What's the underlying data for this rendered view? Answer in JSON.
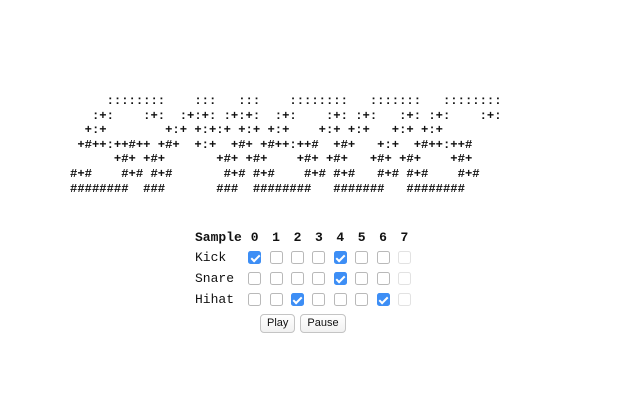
{
  "banner": {
    "lines": [
      "     ::::::::    :::   :::    ::::::::   :::::::   ::::::::",
      "   :+:    :+:  :+:+: :+:+:  :+:    :+: :+:   :+: :+:    :+:",
      "  +:+        +:+ +:+:+ +:+ +:+    +:+ +:+   +:+ +:+",
      " +#++:++#++ +#+  +:+  +#+ +#++:++#  +#+   +:+  +#++:++#",
      "      +#+ +#+       +#+ +#+    +#+ +#+   +#+ +#+    +#+",
      "#+#    #+# #+#       #+# #+#    #+# #+#   #+# #+#    #+#",
      "########  ###       ###  ########   #######   ########"
    ]
  },
  "sequencer": {
    "header_label": "Sample",
    "steps": [
      "0",
      "1",
      "2",
      "3",
      "4",
      "5",
      "6",
      "7"
    ],
    "rows": [
      {
        "label": "Kick",
        "steps": [
          true,
          false,
          false,
          false,
          true,
          false,
          false,
          false
        ]
      },
      {
        "label": "Snare",
        "steps": [
          false,
          false,
          false,
          false,
          true,
          false,
          false,
          false
        ]
      },
      {
        "label": "Hihat",
        "steps": [
          false,
          false,
          true,
          false,
          false,
          false,
          true,
          false
        ]
      }
    ]
  },
  "controls": {
    "play_label": "Play",
    "pause_label": "Pause"
  },
  "colors": {
    "checked": "#3d8ef5",
    "unchecked_border": "#b9b9b9"
  }
}
